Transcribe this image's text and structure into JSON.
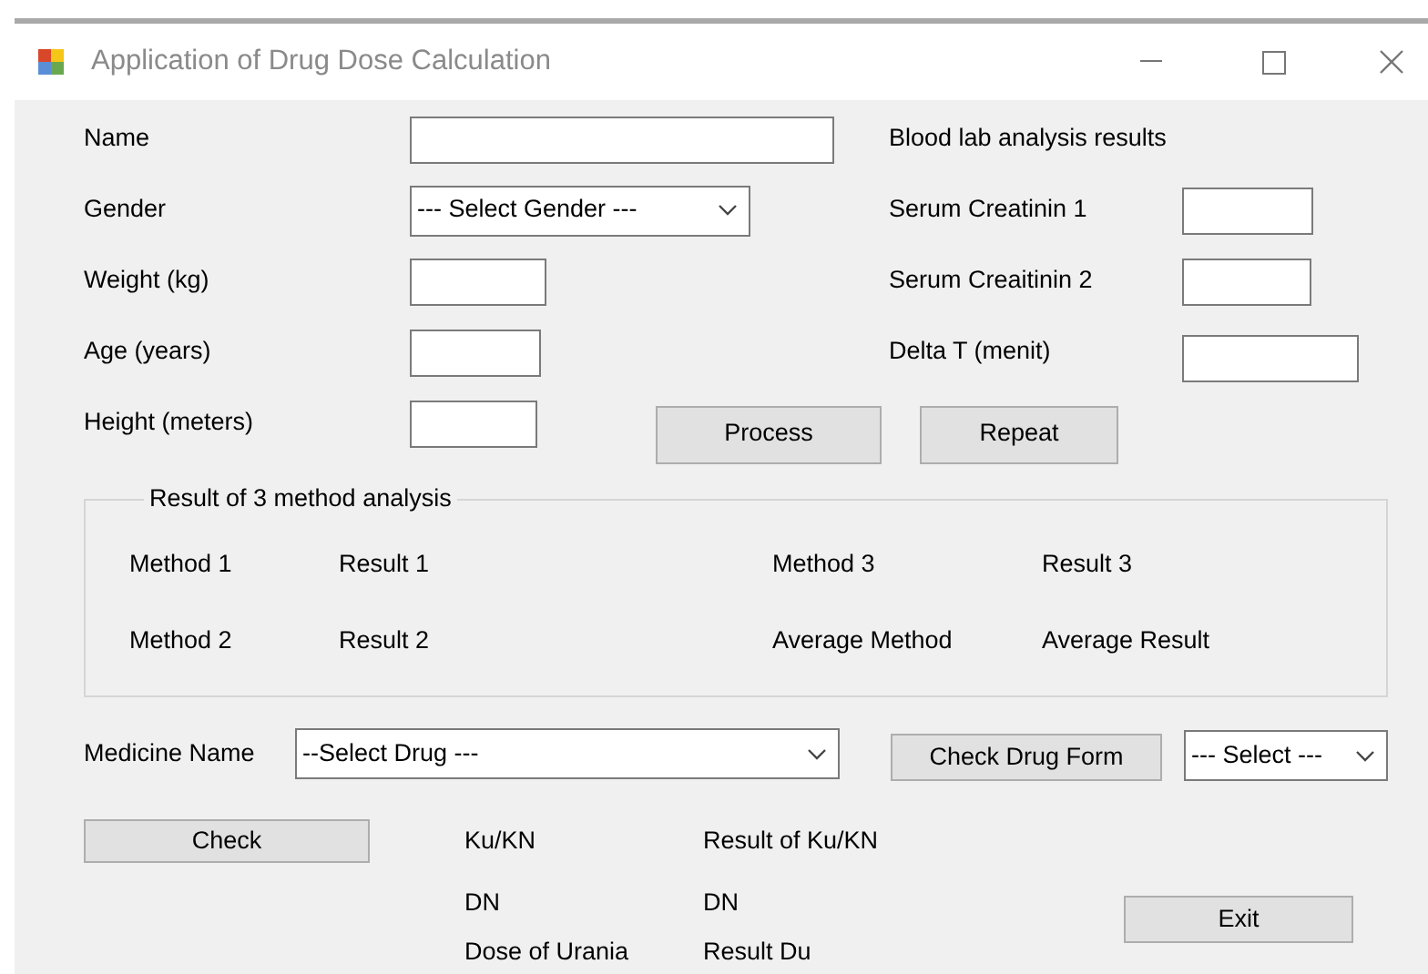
{
  "window": {
    "title": "Application of Drug Dose Calculation"
  },
  "patient_fields": [
    {
      "label": "Name",
      "kind": "text"
    },
    {
      "label": "Gender",
      "kind": "combo",
      "value": "--- Select Gender ---"
    },
    {
      "label": "Weight (kg)",
      "kind": "text"
    },
    {
      "label": "Age (years)",
      "kind": "text"
    },
    {
      "label": "Height (meters)",
      "kind": "text"
    }
  ],
  "lab": {
    "heading": "Blood lab analysis results",
    "fields": [
      {
        "label": "Serum Creatinin 1"
      },
      {
        "label": "Serum Creaitinin 2"
      },
      {
        "label": "Delta T (menit)"
      }
    ]
  },
  "buttons": [
    "Process",
    "Repeat"
  ],
  "results_group": {
    "title": "Result of 3 method analysis",
    "rows": [
      [
        "Method 1",
        "Result 1",
        "Method 3",
        "Result 3"
      ],
      [
        "Method 2",
        "Result 2",
        "Average Method",
        "Average Result"
      ]
    ]
  },
  "medicine": {
    "label": "Medicine Name",
    "drug_combo": "--Select Drug ---",
    "form_button": "Check Drug Form",
    "form_combo": "--- Select ---"
  },
  "check_button": "Check",
  "outputs": [
    {
      "label": "Ku/KN",
      "result": "Result of Ku/KN"
    },
    {
      "label": "DN",
      "result": "DN"
    },
    {
      "label": "Dose of Urania",
      "result": "Result Du"
    }
  ],
  "exit_button": "Exit"
}
